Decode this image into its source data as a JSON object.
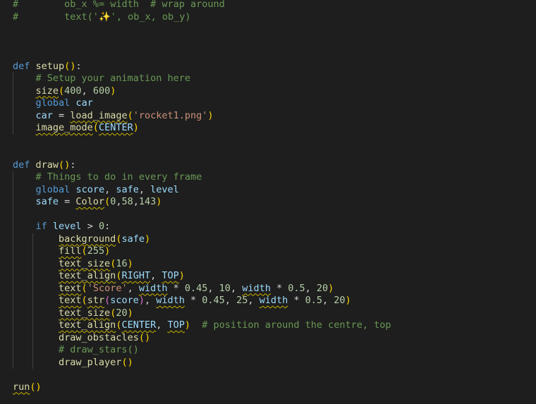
{
  "editor": {
    "language": "python",
    "colors": {
      "background": "#1e1e1e",
      "keyword": "#569cd6",
      "function": "#dcdcaa",
      "variable": "#9cdcfe",
      "number": "#b5cea8",
      "string": "#ce9178",
      "comment": "#6a9955",
      "bracket": "#ffd700",
      "bracket_nested": "#da70d6",
      "squiggle": "#c8b400"
    },
    "lines": [
      [
        "#",
        "        ",
        "ob_x %= width  # wrap around"
      ],
      [
        "#",
        "        ",
        "text('✨', ob_x, ob_y)"
      ],
      [],
      [],
      [],
      [
        "def",
        " ",
        "setup",
        "(",
        ")",
        ":"
      ],
      [
        "    ",
        "# Setup your animation here"
      ],
      [
        "    ",
        "size",
        "(",
        "400",
        ", ",
        "600",
        ")"
      ],
      [
        "    ",
        "global",
        " ",
        "car"
      ],
      [
        "    ",
        "car",
        " = ",
        "load_image",
        "(",
        "'rocket1.png'",
        ")"
      ],
      [
        "    ",
        "image_mode",
        "(",
        "CENTER",
        ")"
      ],
      [],
      [],
      [
        "def",
        " ",
        "draw",
        "(",
        ")",
        ":"
      ],
      [
        "    ",
        "# Things to do in every frame"
      ],
      [
        "    ",
        "global",
        " ",
        "score",
        ", ",
        "safe",
        ", ",
        "level"
      ],
      [
        "    ",
        "safe",
        " = ",
        "Color",
        "(",
        "0",
        ",",
        "58",
        ",",
        "143",
        ")"
      ],
      [],
      [
        "    ",
        "if",
        " ",
        "level",
        " > ",
        "0",
        ":"
      ],
      [
        "        ",
        "background",
        "(",
        "safe",
        ")"
      ],
      [
        "        ",
        "fill",
        "(",
        "255",
        ")"
      ],
      [
        "        ",
        "text_size",
        "(",
        "16",
        ")"
      ],
      [
        "        ",
        "text_align",
        "(",
        "RIGHT",
        ", ",
        "TOP",
        ")"
      ],
      [
        "        ",
        "text",
        "(",
        "'Score'",
        ", ",
        "width",
        " * ",
        "0.45",
        ", ",
        "10",
        ", ",
        "width",
        " * ",
        "0.5",
        ", ",
        "20",
        ")"
      ],
      [
        "        ",
        "text",
        "(",
        "str",
        "(",
        "score",
        ")",
        ", ",
        "width",
        " * ",
        "0.45",
        ", ",
        "25",
        ", ",
        "width",
        " * ",
        "0.5",
        ", ",
        "20",
        ")"
      ],
      [
        "        ",
        "text_size",
        "(",
        "20",
        ")"
      ],
      [
        "        ",
        "text_align",
        "(",
        "CENTER",
        ", ",
        "TOP",
        ")",
        "  ",
        "# position around the centre, top"
      ],
      [
        "        ",
        "draw_obstacles",
        "(",
        ")"
      ],
      [
        "        ",
        "# draw_stars()"
      ],
      [
        "        ",
        "draw_player",
        "(",
        ")"
      ],
      [],
      [
        "run",
        "(",
        ")"
      ]
    ]
  }
}
